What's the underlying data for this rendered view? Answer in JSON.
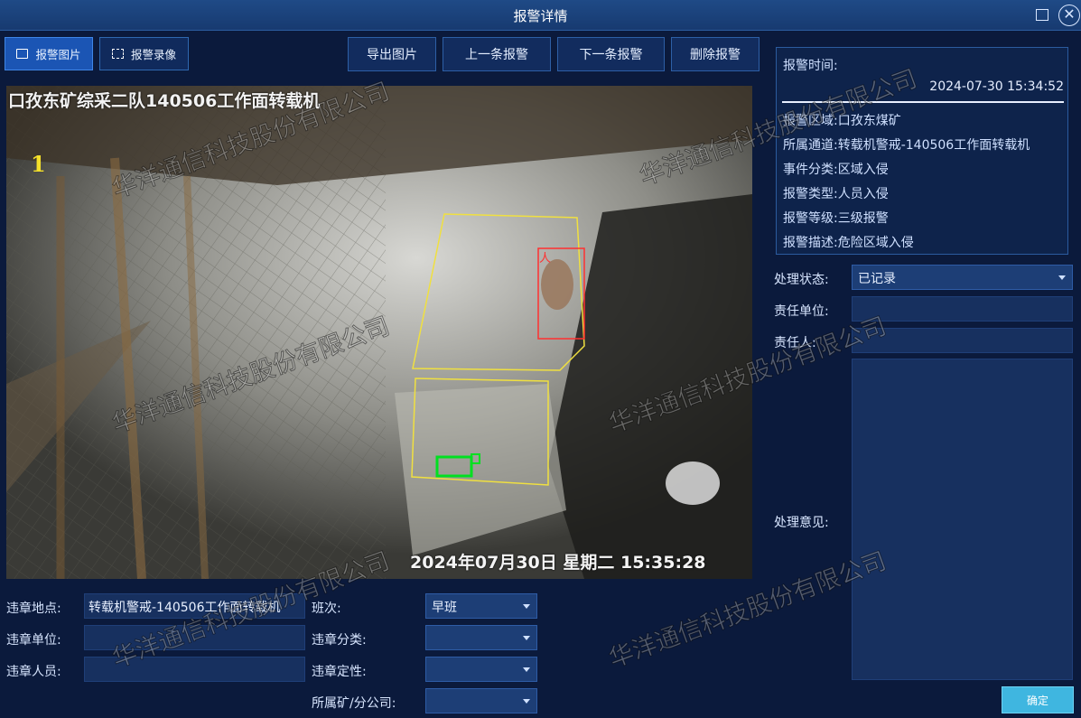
{
  "window": {
    "title": "报警详情"
  },
  "tabs": [
    {
      "label": "报警图片",
      "icon": "image-icon",
      "active": true
    },
    {
      "label": "报警录像",
      "icon": "video-icon",
      "active": false
    }
  ],
  "toolbar": {
    "export_label": "导出图片",
    "prev_label": "上一条报警",
    "next_label": "下一条报警",
    "delete_label": "删除报警"
  },
  "video": {
    "overlay_title": "口孜东矿综采二队140506工作面转载机",
    "channel_number": "1",
    "overlay_timestamp": "2024年07月30日  星期二 15:35:28",
    "detection_label": "人"
  },
  "alarm_info": {
    "time_label": "报警时间:",
    "time_value": "2024-07-30 15:34:52",
    "rows": [
      {
        "label": "报警区域:",
        "value": "口孜东煤矿"
      },
      {
        "label": "所属通道:",
        "value": "转载机警戒-140506工作面转载机"
      },
      {
        "label": "事件分类:",
        "value": "区域入侵"
      },
      {
        "label": "报警类型:",
        "value": "人员入侵"
      },
      {
        "label": "报警等级:",
        "value": "三级报警"
      },
      {
        "label": "报警描述:",
        "value": "危险区域入侵"
      }
    ]
  },
  "processing": {
    "status_label": "处理状态:",
    "status_value": "已记录",
    "unit_label": "责任单位:",
    "unit_value": "",
    "person_label": "责任人:",
    "person_value": "",
    "opinion_label": "处理意见:",
    "opinion_value": "",
    "confirm_label": "确定"
  },
  "violation": {
    "location_label": "违章地点:",
    "location_value": "转载机警戒-140506工作面转载机",
    "unit_label": "违章单位:",
    "unit_value": "",
    "person_label": "违章人员:",
    "person_value": "",
    "shift_label": "班次:",
    "shift_value": "早班",
    "category_label": "违章分类:",
    "category_value": "",
    "nature_label": "违章定性:",
    "nature_value": "",
    "company_label": "所属矿/分公司:",
    "company_value": ""
  },
  "watermark": "华洋通信科技股份有限公司",
  "colors": {
    "background": "#0b1a3c",
    "accent": "#1b55b4",
    "confirm": "#3fb6e0",
    "detection_person": "#ff3030",
    "detection_zone": "#f0e040",
    "detection_object": "#00e020"
  }
}
